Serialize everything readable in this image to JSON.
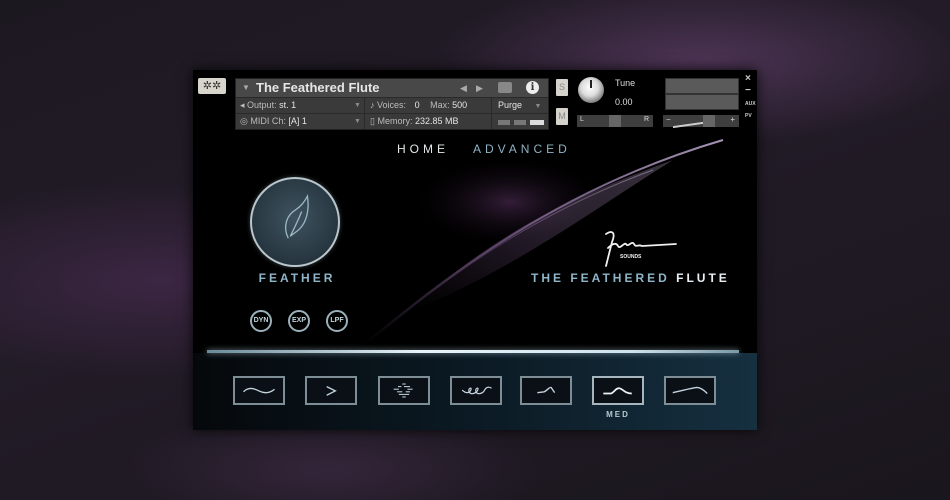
{
  "kontakt": {
    "instrument_name": "The Feathered Flute",
    "output_label": "Output:",
    "output_value": "st. 1",
    "midi_label": "MIDI Ch:",
    "midi_value": "[A]  1",
    "voices_label": "Voices:",
    "voices_value": "0",
    "max_label": "Max:",
    "max_value": "500",
    "memory_label": "Memory:",
    "memory_value": "232.85 MB",
    "purge_label": "Purge",
    "solo_label": "S",
    "mute_label": "M",
    "tune_label": "Tune",
    "tune_value": "0.00",
    "pan_left": "L",
    "pan_right": "R",
    "vol_minus": "−",
    "vol_plus": "+",
    "close": "×",
    "minimize": "−",
    "aux": "AUX",
    "pv": "PV",
    "info_glyph": "i",
    "gear_glyph": "✲✲"
  },
  "tabs": [
    {
      "label": "HOME",
      "active": true,
      "color": "#e4e8ea"
    },
    {
      "label": "ADVANCED",
      "active": false,
      "color": "#8fb2c4"
    }
  ],
  "feather": {
    "label": "FEATHER"
  },
  "toggles": [
    {
      "label": "DYN"
    },
    {
      "label": "EXP"
    },
    {
      "label": "LPF"
    }
  ],
  "brand": {
    "title_part1": "THE FEATHERED ",
    "title_part2": "FLUTE",
    "signature_sub": "SOUNDS"
  },
  "articulations": [
    {
      "name": "legato",
      "icon": "wave"
    },
    {
      "name": "accent",
      "icon": "chevron"
    },
    {
      "name": "flutter",
      "icon": "dashes"
    },
    {
      "name": "trill",
      "icon": "loops"
    },
    {
      "name": "short-swell",
      "icon": "hook"
    },
    {
      "name": "medium-swell",
      "icon": "arch",
      "selected": true,
      "caption": "MED"
    },
    {
      "name": "long-swell",
      "icon": "long-arch"
    }
  ],
  "colors": {
    "accent": "#8fb5c8",
    "panel_bg": "#000000"
  }
}
